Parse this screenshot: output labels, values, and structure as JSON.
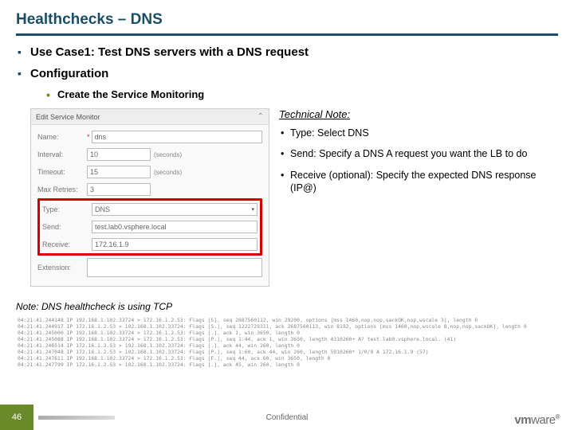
{
  "title": "Healthchecks – DNS",
  "h1": "Use Case1: Test DNS servers with a DNS request",
  "h2": "Configuration",
  "sub1": "Create the Service Monitoring",
  "form": {
    "head": "Edit Service Monitor",
    "labels": {
      "name": "Name:",
      "interval": "Interval:",
      "timeout": "Timeout:",
      "max_retries": "Max Retries:",
      "type": "Type:",
      "send": "Send:",
      "receive": "Receive:",
      "extension": "Extension:"
    },
    "values": {
      "name": "dns",
      "interval": "10",
      "timeout": "15",
      "max_retries": "3",
      "type": "DNS",
      "send": "test.lab0.vsphere.local",
      "receive": "172.16.1.9"
    },
    "suffix_seconds": "(seconds)"
  },
  "notes": {
    "head": "Technical Note:",
    "n1": "Type: Select DNS",
    "n2": "Send: Specify a DNS A request you want the LB to do",
    "n3": "Receive (optional): Specify the expected DNS response (IP@)"
  },
  "note_tcp": "Note: DNS healthcheck is using TCP",
  "tcpdump": "04:21:41.244148 IP 192.168.1.102.33724 > 172.16.1.2.53: Flags [S], seq 2687560112, win 29200, options [mss 1460,nop,nop,sackOK,nop,wscale 3], length 0\n04:21:41.244917 IP 172.16.1.2.53 > 192.168.1.102.33724: Flags [S.], seq 1222729311, ack 2687560113, win 8192, options [mss 1460,nop,wscale 8,nop,nop,sackOK], length 0\n04:21:41.245000 IP 192.168.1.102.33724 > 172.16.1.2.53: Flags [.], ack 1, win 3650, length 0\n04:21:41.245088 IP 192.168.1.102.33724 > 172.16.1.2.53: Flags [P.], seq 1:44, ack 1, win 3650, length 4310260+ A? test.lab0.vsphere.local. (41)\n04:21:41.246514 IP 172.16.1.2.53 > 192.168.1.102.33724: Flags [.], ack 44, win 260, length 0\n04:21:41.247048 IP 172.16.1.2.53 > 192.168.1.102.33724: Flags [P.], seq 1:60, ack 44, win 260, length 5910260* 1/0/0 A 172.16.1.9 (57)\n04:21:41.247611 IP 192.168.1.102.33724 > 172.16.1.2.53: Flags [F.], seq 44, ack 60, win 3650, length 0\n04:21:41.247799 IP 172.16.1.2.53 > 192.168.1.102.33724: Flags [.], ack 45, win 260, length 0",
  "footer": {
    "page": "46",
    "conf": "Confidential",
    "logo_vm": "vm",
    "logo_ware": "ware"
  }
}
